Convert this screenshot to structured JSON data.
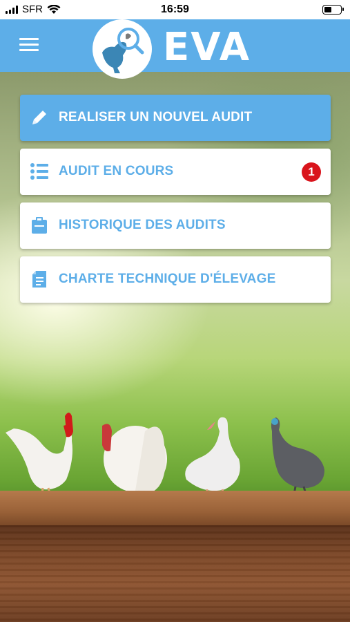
{
  "status_bar": {
    "carrier": "SFR",
    "time": "16:59"
  },
  "header": {
    "app_name": "EVA"
  },
  "menu": {
    "items": [
      {
        "label": "REALISER UN NOUVEL AUDIT",
        "icon": "pencil-icon"
      },
      {
        "label": "AUDIT EN COURS",
        "icon": "list-icon",
        "badge": "1"
      },
      {
        "label": "HISTORIQUE DES AUDITS",
        "icon": "clipboard-icon"
      },
      {
        "label": "CHARTE TECHNIQUE D'ÉLEVAGE",
        "icon": "document-icon"
      }
    ]
  },
  "colors": {
    "brand": "#5daee8",
    "badge": "#d9141c"
  }
}
